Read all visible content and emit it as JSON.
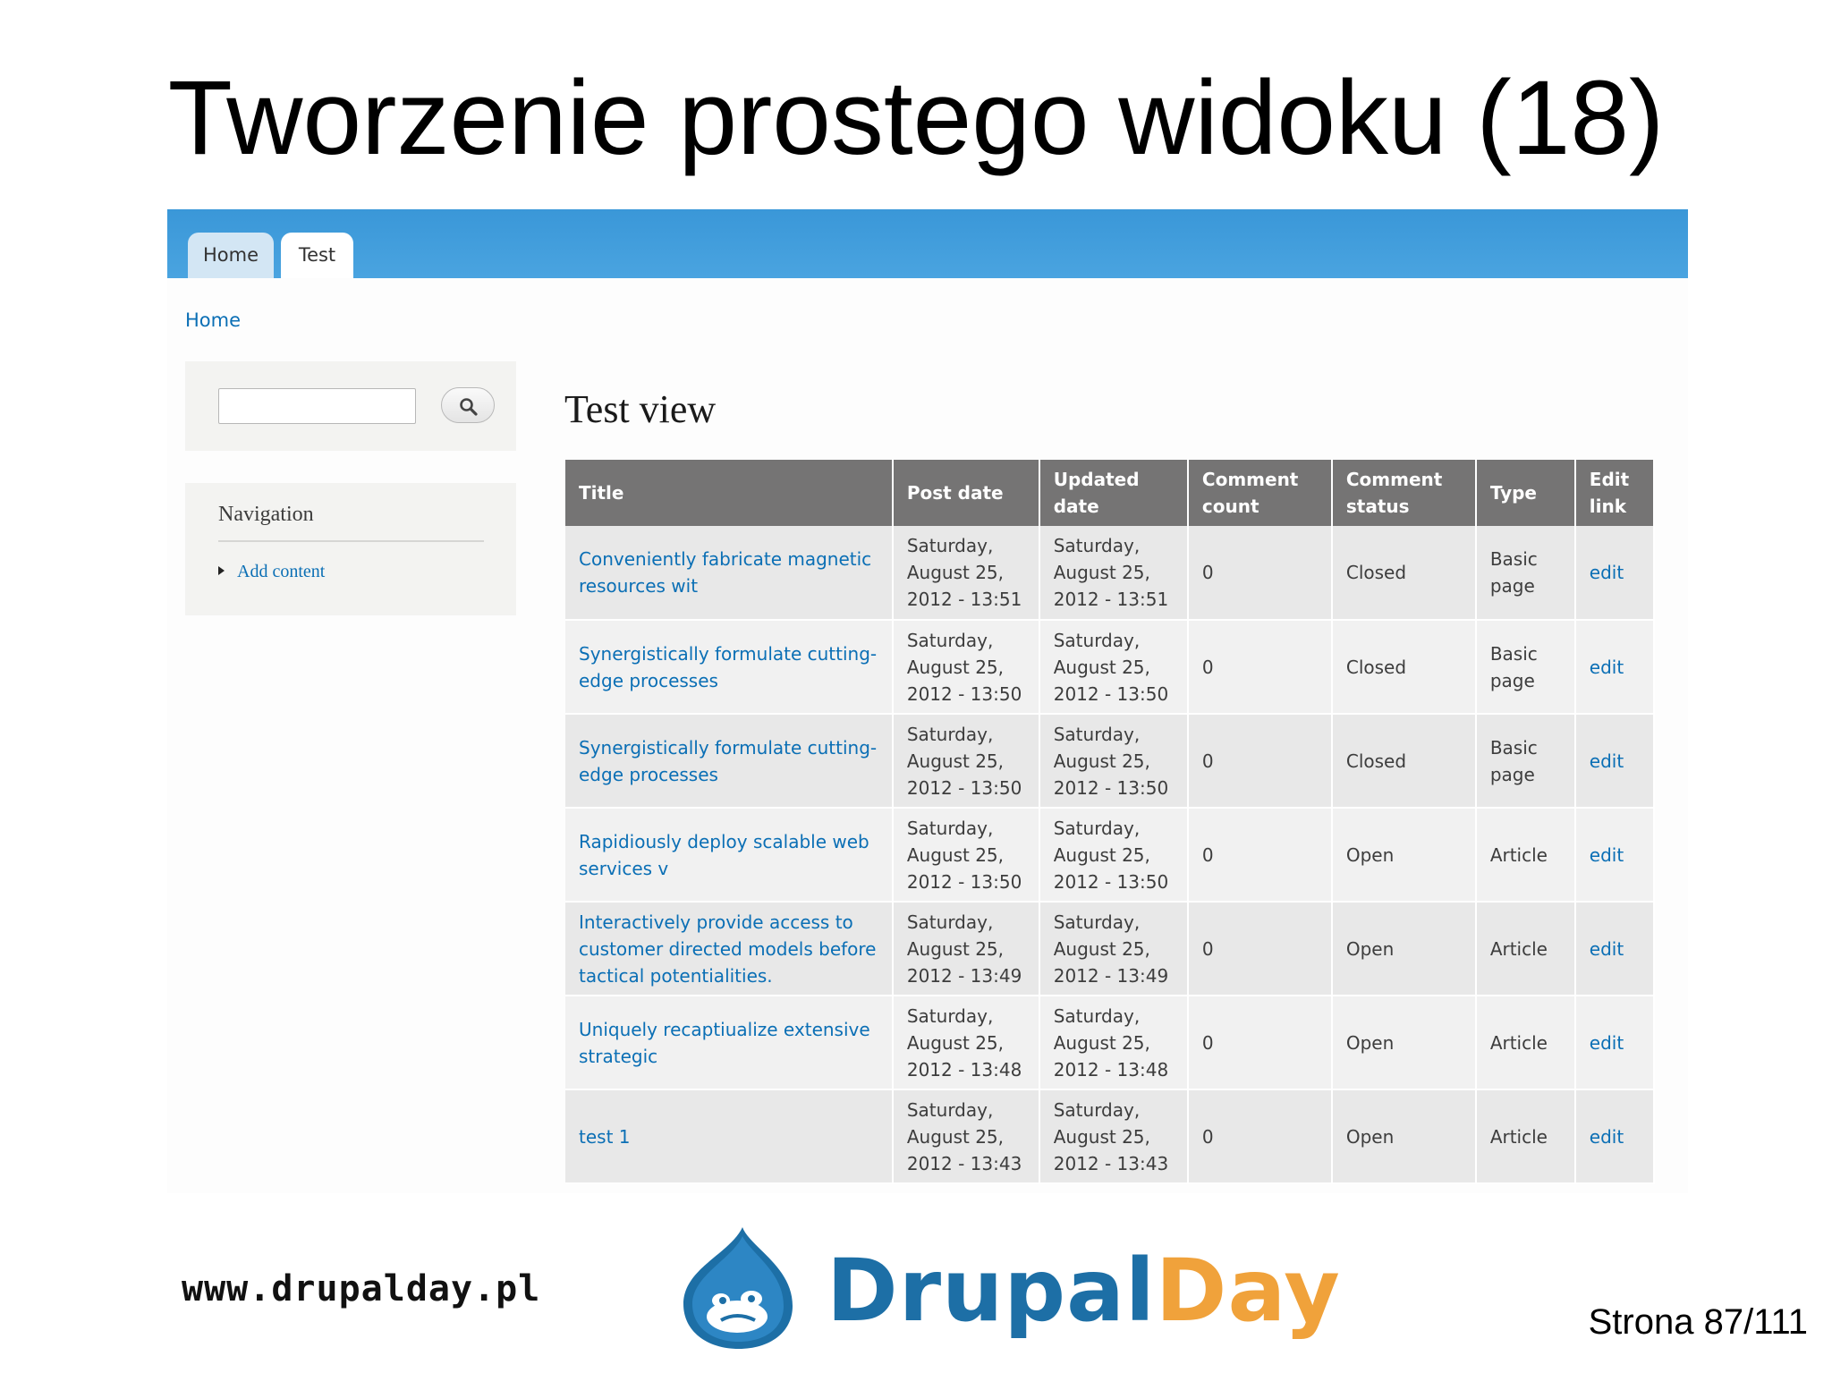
{
  "slide": {
    "title": "Tworzenie prostego widoku (18)",
    "footer_url": "www.drupalday.pl",
    "logo_part1": "Drupal",
    "logo_part2": "Day",
    "page_number": "Strona 87/111"
  },
  "colors": {
    "topbar": "#3a97d8",
    "link": "#0b6fb5",
    "table_header": "#757474",
    "logo_blue": "#1d6fa6",
    "logo_orange": "#f0a23b"
  },
  "site": {
    "tabs": [
      {
        "label": "Home"
      },
      {
        "label": "Test"
      }
    ],
    "breadcrumb": "Home",
    "search": {
      "icon": "search-icon",
      "value": ""
    },
    "navigation": {
      "title": "Navigation",
      "items": [
        {
          "label": "Add content"
        }
      ]
    },
    "view_title": "Test view",
    "table": {
      "headers": [
        "Title",
        "Post date",
        "Updated date",
        "Comment count",
        "Comment status",
        "Type",
        "Edit link"
      ],
      "rows": [
        {
          "title": "Conveniently fabricate magnetic resources wit",
          "post_date": [
            "Saturday,",
            "August 25,",
            "2012 - 13:51"
          ],
          "updated_date": [
            "Saturday,",
            "August 25,",
            "2012 - 13:51"
          ],
          "comment_count": "0",
          "comment_status": "Closed",
          "type": "Basic page",
          "edit": "edit"
        },
        {
          "title": "Synergistically formulate cutting-edge processes",
          "post_date": [
            "Saturday,",
            "August 25,",
            "2012 - 13:50"
          ],
          "updated_date": [
            "Saturday,",
            "August 25,",
            "2012 - 13:50"
          ],
          "comment_count": "0",
          "comment_status": "Closed",
          "type": "Basic page",
          "edit": "edit"
        },
        {
          "title": "Synergistically formulate cutting-edge processes",
          "post_date": [
            "Saturday,",
            "August 25,",
            "2012 - 13:50"
          ],
          "updated_date": [
            "Saturday,",
            "August 25,",
            "2012 - 13:50"
          ],
          "comment_count": "0",
          "comment_status": "Closed",
          "type": "Basic page",
          "edit": "edit"
        },
        {
          "title": "Rapidiously deploy scalable web services v",
          "post_date": [
            "Saturday,",
            "August 25,",
            "2012 - 13:50"
          ],
          "updated_date": [
            "Saturday,",
            "August 25,",
            "2012 - 13:50"
          ],
          "comment_count": "0",
          "comment_status": "Open",
          "type": "Article",
          "edit": "edit"
        },
        {
          "title": "Interactively provide access to customer directed models before tactical potentialities.",
          "post_date": [
            "Saturday,",
            "August 25,",
            "2012 - 13:49"
          ],
          "updated_date": [
            "Saturday,",
            "August 25,",
            "2012 - 13:49"
          ],
          "comment_count": "0",
          "comment_status": "Open",
          "type": "Article",
          "edit": "edit"
        },
        {
          "title": "Uniquely recaptiualize extensive strategic",
          "post_date": [
            "Saturday,",
            "August 25,",
            "2012 - 13:48"
          ],
          "updated_date": [
            "Saturday,",
            "August 25,",
            "2012 - 13:48"
          ],
          "comment_count": "0",
          "comment_status": "Open",
          "type": "Article",
          "edit": "edit"
        },
        {
          "title": "test 1",
          "post_date": [
            "Saturday,",
            "August 25,",
            "2012 - 13:43"
          ],
          "updated_date": [
            "Saturday,",
            "August 25,",
            "2012 - 13:43"
          ],
          "comment_count": "0",
          "comment_status": "Open",
          "type": "Article",
          "edit": "edit"
        }
      ]
    }
  }
}
